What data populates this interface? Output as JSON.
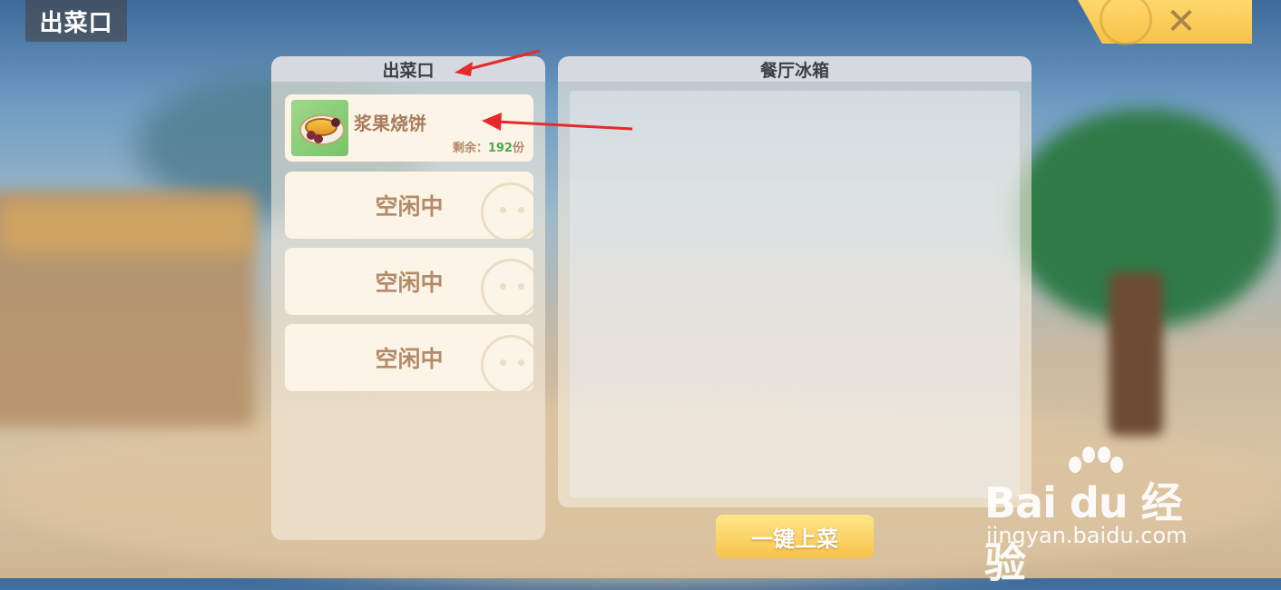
{
  "window": {
    "title": "出菜口"
  },
  "serving_window": {
    "header": "出菜口",
    "slots": [
      {
        "state": "occupied",
        "dish_name": "浆果烧饼",
        "remain_label": "剩余：",
        "remain_count": "192",
        "remain_unit": "份"
      },
      {
        "state": "idle",
        "label": "空闲中"
      },
      {
        "state": "idle",
        "label": "空闲中"
      },
      {
        "state": "idle",
        "label": "空闲中"
      }
    ]
  },
  "fridge": {
    "header": "餐厅冰箱"
  },
  "actions": {
    "serve_all": "一键上菜",
    "close_icon": "close-icon"
  },
  "annotations": {
    "arrow_color": "#e52a2a"
  },
  "watermark": {
    "brand": "Bai du 经验",
    "url": "jingyan.baidu.com"
  }
}
